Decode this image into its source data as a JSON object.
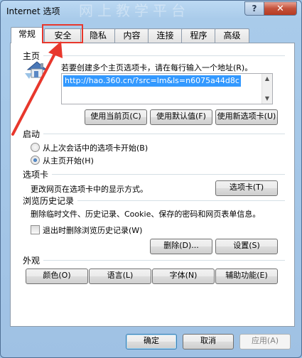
{
  "window": {
    "title": "Internet 选项",
    "title_watermark": "网上教学平台",
    "help_glyph": "?",
    "close_glyph": "✕"
  },
  "tabs": [
    "常规",
    "安全",
    "隐私",
    "内容",
    "连接",
    "程序",
    "高级"
  ],
  "active_tab": "常规",
  "homepage": {
    "section_title": "主页",
    "hint": "若要创建多个主页选项卡，请在每行输入一个地址(R)。",
    "url": "http://hao.360.cn/?src=lm&ls=n6075a44d8c",
    "buttons": [
      "使用当前页(C)",
      "使用默认值(F)",
      "使用新选项卡(U)"
    ]
  },
  "startup": {
    "section_title": "启动",
    "options": [
      "从上次会话中的选项卡开始(B)",
      "从主页开始(H)"
    ],
    "selected_index": 1
  },
  "tabs_section": {
    "section_title": "选项卡",
    "description": "更改网页在选项卡中的显示方式。",
    "button": "选项卡(T)"
  },
  "history": {
    "section_title": "浏览历史记录",
    "description": "删除临时文件、历史记录、Cookie、保存的密码和网页表单信息。",
    "checkbox_label": "退出时删除浏览历史记录(W)",
    "checkbox_checked": false,
    "delete_button": "删除(D)...",
    "settings_button": "设置(S)"
  },
  "appearance": {
    "section_title": "外观",
    "buttons": [
      "颜色(O)",
      "语言(L)",
      "字体(N)",
      "辅助功能(E)"
    ]
  },
  "footer": {
    "ok": "确定",
    "cancel": "取消",
    "apply": "应用(A)"
  },
  "colors": {
    "annotation": "#e8372c",
    "selection": "#3399ff"
  }
}
